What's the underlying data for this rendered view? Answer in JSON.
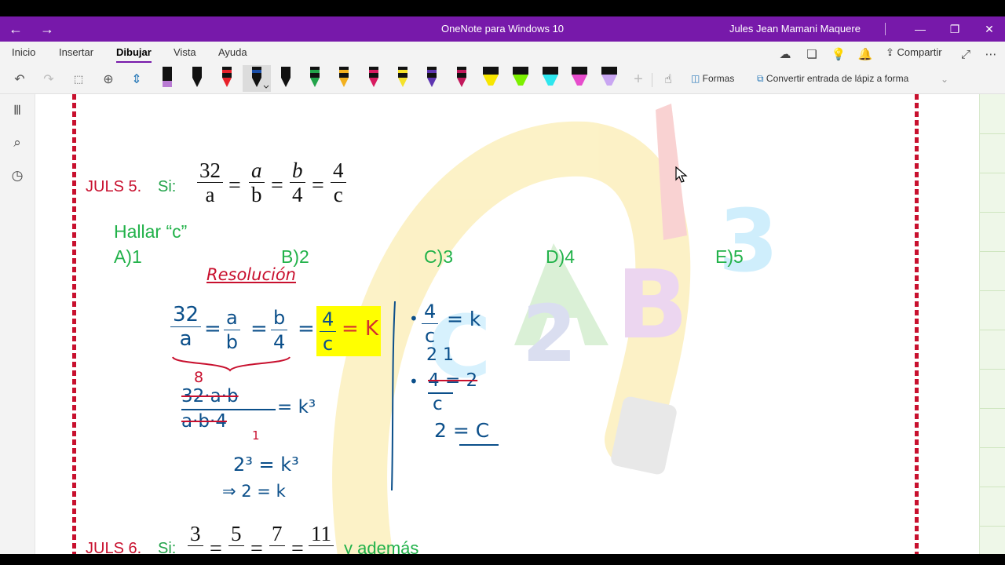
{
  "window": {
    "title": "OneNote para Windows 10",
    "user": "Jules Jean Mamani Maquere",
    "back_icon": "arrow-left-icon",
    "forward_icon": "arrow-right-icon"
  },
  "tabs": [
    {
      "label": "Inicio"
    },
    {
      "label": "Insertar"
    },
    {
      "label": "Dibujar",
      "active": true
    },
    {
      "label": "Vista"
    },
    {
      "label": "Ayuda"
    }
  ],
  "toolbar_right": {
    "share_label": "Compartir"
  },
  "draw_tools": {
    "shapes_label": "Formas",
    "convert_label": "Convertir entrada de lápiz a forma"
  },
  "pen_colors": [
    "#b97bd3",
    "#1a1a1a",
    "#e8202a",
    "#1a1a1a",
    "#1a1a1a",
    "#22a34a",
    "#f2b01e",
    "#d81b60",
    "#f4e22a",
    "#5e35b1",
    "#c2185b",
    "#f7e600",
    "#7cf000",
    "#2ee6ee",
    "#e64ccc",
    "#c9a6f2"
  ],
  "colors": {
    "accent": "#7719aa",
    "problem_red": "#c8102e",
    "problem_green": "#22b24a",
    "ink_blue": "#0b4f8a",
    "highlight_yellow": "#ffff00"
  },
  "problem5": {
    "label": "JULS 5.",
    "si": "Si:",
    "eq_sign": "=",
    "fractions": [
      {
        "num": "32",
        "den": "a"
      },
      {
        "num": "a",
        "den": "b"
      },
      {
        "num": "b",
        "den": "4"
      },
      {
        "num": "4",
        "den": "c"
      }
    ],
    "question": "Hallar “c”",
    "options": [
      "A)1",
      "B)2",
      "C)3",
      "D)4",
      "E)5"
    ]
  },
  "handwriting": {
    "heading": "Resolución",
    "main_eq": "32/a = a/b = b/4 = 4/c = k",
    "product_top": "32·a·b",
    "product_bottom": "a·b·4",
    "product_k": "= k³",
    "eight": "8",
    "one": "1",
    "step_cube": "2³ = k³",
    "step_result": "⇒ 2 = k",
    "right_eq": "4/c = k",
    "right_step1": "4 = 2",
    "right_small": "2   1",
    "right_result": "2 = C",
    "k": "k"
  },
  "problem6": {
    "label": "JULS 6.",
    "si": "Si:",
    "fractions": [
      {
        "num": "3"
      },
      {
        "num": "5"
      },
      {
        "num": "7"
      },
      {
        "num": "11"
      }
    ],
    "trailing": "y además"
  }
}
